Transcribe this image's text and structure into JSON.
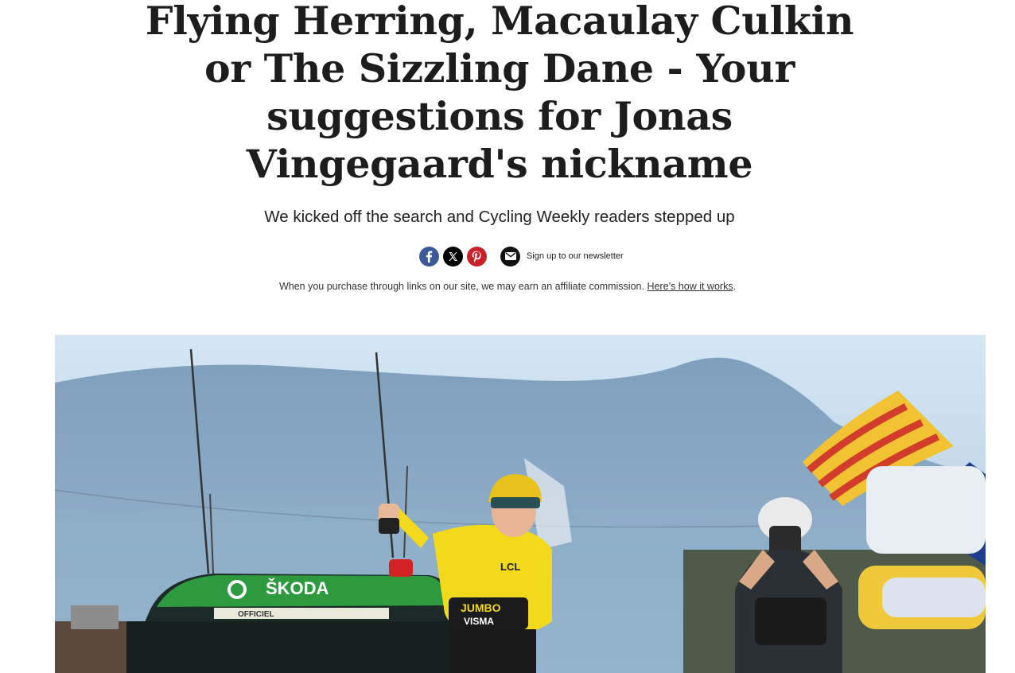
{
  "article": {
    "headline": "Flying Herring, Macaulay Culkin or The Sizzling Dane - Your suggestions for Jonas Vingegaard's nickname",
    "subheadline": "We kicked off the search and Cycling Weekly readers stepped up"
  },
  "share": {
    "icons": [
      {
        "name": "facebook-icon",
        "color": "#3b5998"
      },
      {
        "name": "x-icon",
        "color": "#000000"
      },
      {
        "name": "pinterest-icon",
        "color": "#cb2027"
      }
    ],
    "newsletter_label": "Sign up to our newsletter"
  },
  "affiliate": {
    "text": "When you purchase through links on our site, we may earn an affiliate commission. ",
    "link_text": "Here’s how it works",
    "trailing": "."
  },
  "hero_image": {
    "car_brand": "ŠKODA",
    "car_plate": "OFFICIEL",
    "jersey_sponsors": [
      "JUMBO",
      "VISMA",
      "LCL"
    ]
  }
}
